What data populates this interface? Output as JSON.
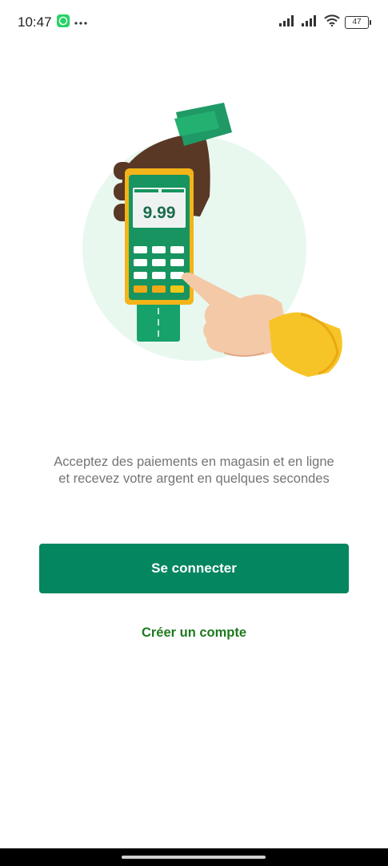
{
  "status_bar": {
    "time": "10:47",
    "battery": "47",
    "notification_icons": [
      "whatsapp-icon",
      "more-dots-icon"
    ],
    "system_icons": [
      "signal-icon",
      "signal-icon",
      "wifi-icon",
      "battery-icon"
    ]
  },
  "hero": {
    "terminal_amount": "9.99"
  },
  "tagline": {
    "line1": "Acceptez des paiements en magasin et en ligne",
    "line2": "et recevez votre argent en quelques secondes"
  },
  "actions": {
    "login_label": "Se connecter",
    "create_account_label": "Créer un compte"
  },
  "colors": {
    "primary": "#048660",
    "link": "#1e7a1e",
    "hero_circle": "#e8f8ef"
  }
}
